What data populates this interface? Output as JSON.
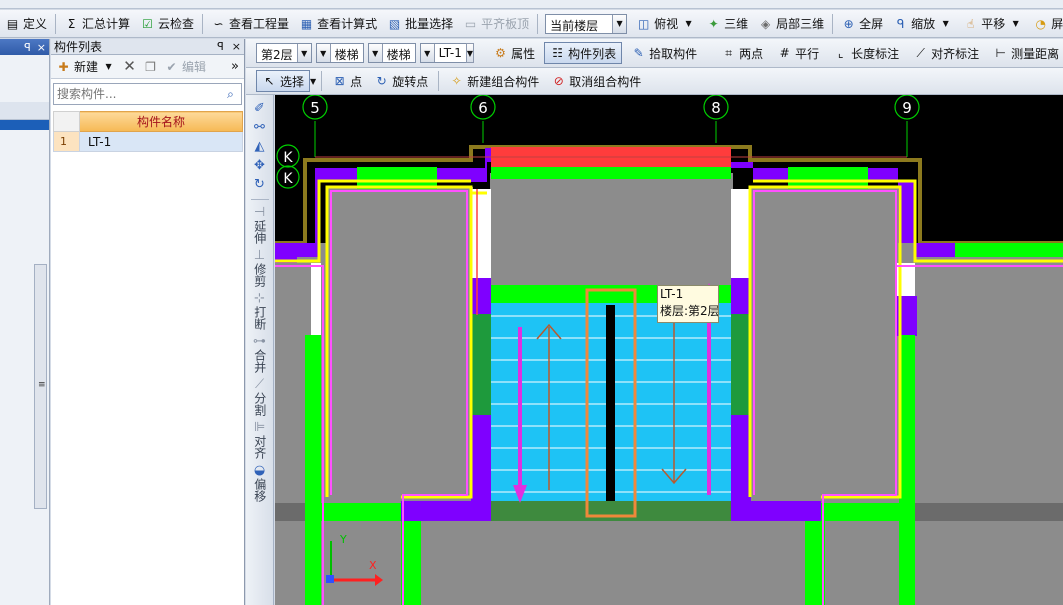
{
  "toolbar": {
    "define": "定义",
    "summary_calc": "汇总计算",
    "cloud_check": "云检查",
    "view_quantity": "查看工程量",
    "view_formula": "查看计算式",
    "batch_select": "批量选择",
    "flush_slab_top": "平齐板顶",
    "current_floor": "当前楼层",
    "top_view": "俯视",
    "view_3d": "三维",
    "local_3d": "局部三维",
    "full_screen": "全屏",
    "zoom": "缩放",
    "pan": "平移",
    "screen_rotate": "屏幕旋转"
  },
  "left_pane": {
    "close_glyph": "×",
    "pin_glyph": "ꟼ",
    "scroll_grip": "≡"
  },
  "component_pane": {
    "title": "构件列表",
    "new_label": "新建",
    "edit_label": "编辑",
    "more_glyph": "»",
    "search_placeholder": "搜索构件...",
    "column_name": "构件名称",
    "rows": [
      {
        "index": "1",
        "name": "LT-1"
      }
    ]
  },
  "toolbar2": {
    "floor": "第2层",
    "category": "楼梯",
    "type": "楼梯",
    "component": "LT-1",
    "properties": "属性",
    "component_list": "构件列表",
    "pick_component": "拾取构件",
    "two_points": "两点",
    "parallel": "平行",
    "length_dimension": "长度标注",
    "aligned_dimension": "对齐标注",
    "measure_distance": "测量距离"
  },
  "toolbar3": {
    "select": "选择",
    "point": "点",
    "rotate_point": "旋转点",
    "new_group": "新建组合构件",
    "cancel_group": "取消组合构件"
  },
  "vertical_tools": {
    "extend": "延伸",
    "trim": "修剪",
    "break": "打断",
    "merge": "合并",
    "split": "分割",
    "align": "对齐",
    "offset": "偏移"
  },
  "canvas": {
    "axis_labels": [
      "5",
      "6",
      "8",
      "9"
    ],
    "row_labels": [
      "K",
      "K"
    ],
    "ucs_x": "X",
    "ucs_y": "Y",
    "tooltip": {
      "name": "LT-1",
      "floor": "楼层:第2层"
    },
    "colors": {
      "background": "#000000",
      "wall_purple": "#7f00ff",
      "column_green": "#00ff00",
      "stair_cyan": "#1ec3f5",
      "gray_fill": "#8c8c8c",
      "beam_red": "#ff3c3c",
      "yellow_line": "#ffff00",
      "pink_line": "#ff50ff",
      "olive_line": "#8c7a1e"
    }
  }
}
